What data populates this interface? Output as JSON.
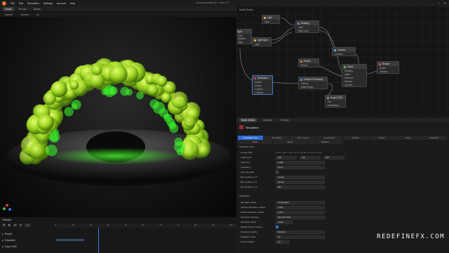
{
  "menubar": {
    "items": [
      "File",
      "Edit",
      "Simulation",
      "Settings",
      "Account",
      "Help"
    ],
    "window_title": "arena-simulation.jbl - embr 2.0"
  },
  "viewport": {
    "tabs": [
      "Scene",
      "Render",
      "Assets"
    ],
    "toolbar": [
      "Default",
      "Camera",
      "Lit"
    ]
  },
  "nodegraph": {
    "title": "Node Graph",
    "nodes": {
      "light1": {
        "title": "Light",
        "rows": [
          "Light"
        ]
      },
      "shading": {
        "title": "Shading",
        "rows": [
          "Light",
          "Base color"
        ]
      },
      "light2": {
        "title": "Light",
        "rows": [
          "Cast shadow",
          "Light"
        ]
      },
      "lightspot": {
        "title": "Light Spot",
        "rows": [
          "Light"
        ]
      },
      "camera": {
        "title": "Camera",
        "rows": [
          "Camera"
        ]
      },
      "shading2": {
        "title": "Shading",
        "rows": [
          "Light"
        ]
      },
      "scene": {
        "title": "Scene",
        "rows": [
          "Shading",
          "Lights",
          "Volumes",
          "Meshes",
          "Camera"
        ]
      },
      "render": {
        "title": "Render",
        "rows": [
          "Scene",
          "Camera"
        ]
      },
      "preset": {
        "title": "Preset",
        "rows": [
          "Preset"
        ]
      },
      "simulation": {
        "title": "Simulation",
        "rows": [
          "Emitter",
          "Forces",
          "Collision",
          "Colliders"
        ]
      },
      "volumeproc": {
        "title": "Volume Processing",
        "rows": [
          "Volume",
          "Mask Range"
        ]
      },
      "exportvdb": {
        "title": "Export VDB",
        "rows": [
          "File",
          "Parameters"
        ]
      }
    }
  },
  "props": {
    "tabs": [
      "Node Details",
      "Inspector",
      "Timeline"
    ],
    "title": "Simulation",
    "subtabs1": [
      "Simulation Box",
      "Simulation",
      "Time Control",
      "Combustion",
      "Vorticity",
      "Forces",
      "Wind",
      "Modelling"
    ],
    "subtabs2": [
      "Mask",
      "Shear",
      "Particles"
    ],
    "section1": "Simulation Box",
    "section2": "Simulation",
    "rows1": [
      {
        "label": "Current Size",
        "value": "1000 × 854 × 900 = 0.7M (96 Mb, 50 million cells)"
      },
      {
        "label": "Voxel count",
        "value": "100"
      },
      {
        "label": "Voxel size",
        "value": "0.100"
      },
      {
        "label": "Spreading",
        "value": "None"
      },
      {
        "label": "Pivot Specular",
        "value": ""
      },
      {
        "label": "Box position on X",
        "value": "Center"
      },
      {
        "label": "Box position on Y",
        "value": "Center"
      },
      {
        "label": "Box position on Z",
        "value": "Min"
      }
    ],
    "rows2": [
      {
        "label": "Simulation Mode",
        "value": "Combustion"
      },
      {
        "label": "Velocity Advection method",
        "value": "Cubic"
      },
      {
        "label": "Scalar Advection method",
        "value": "Cubic"
      },
      {
        "label": "Advection accuracy",
        "value": "Second Order"
      },
      {
        "label": "Advection Offset",
        "value": "0.000"
      },
      {
        "label": "Disable Ghost Collision",
        "value": ""
      },
      {
        "label": "Projection Quality",
        "value": "Medium"
      },
      {
        "label": "Multigrid Cycles",
        "value": "10"
      },
      {
        "label": "Noise Gradient",
        "value": "On"
      }
    ],
    "voxel_count_extra": [
      "100",
      "100"
    ]
  },
  "timeline": {
    "title": "Timeline",
    "frame": "0",
    "ticks": [
      "0",
      "10",
      "20",
      "30",
      "40",
      "50",
      "60",
      "70",
      "80",
      "90",
      "100"
    ],
    "tracks": [
      "Render",
      "Simulation",
      "Export VDB"
    ],
    "playhead_frame": 25
  },
  "watermark": "REDEFINEFX.COM",
  "colors": {
    "accent": "#2f6bd8",
    "simulation_icon": "#8d2b3c",
    "plume": "#a8e62e"
  }
}
